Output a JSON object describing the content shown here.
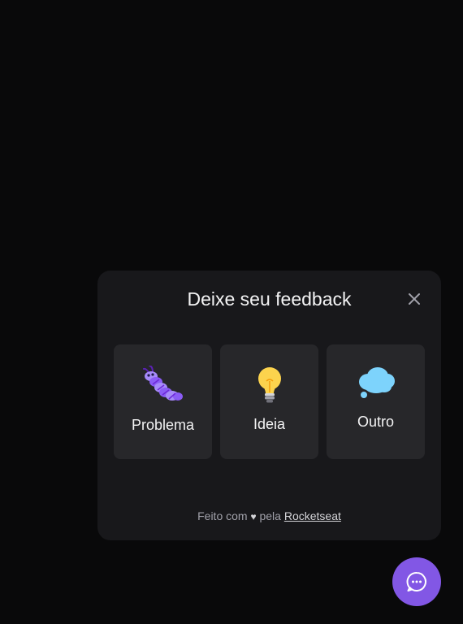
{
  "widget": {
    "title": "Deixe seu feedback",
    "close_icon": "close-icon",
    "options": [
      {
        "label": "Problema",
        "icon": "bug-icon"
      },
      {
        "label": "Ideia",
        "icon": "lightbulb-icon"
      },
      {
        "label": "Outro",
        "icon": "thought-cloud-icon"
      }
    ],
    "footer": {
      "prefix": "Feito com",
      "heart": "♥",
      "middle": "pela",
      "brand": "Rocketseat"
    }
  },
  "fab": {
    "icon": "chat-icon"
  },
  "colors": {
    "background": "#09090a",
    "panel": "#18181b",
    "card": "#27272a",
    "brand": "#8257e5"
  }
}
